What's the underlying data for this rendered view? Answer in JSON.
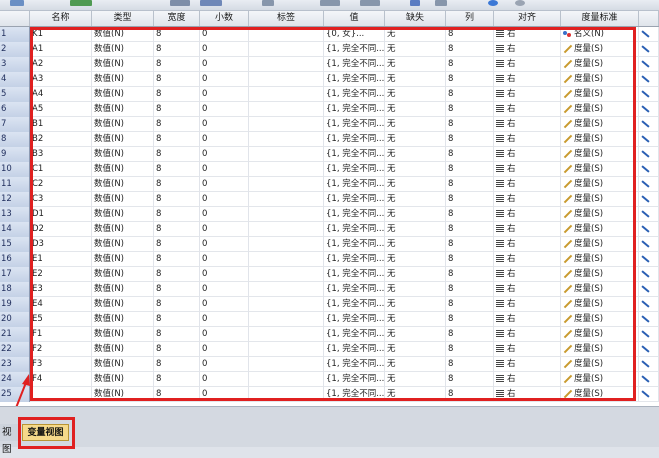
{
  "columns": [
    "名称",
    "类型",
    "宽度",
    "小数",
    "标签",
    "值",
    "缺失",
    "列",
    "对齐",
    "度量标准"
  ],
  "rows": [
    {
      "num": "1",
      "name": "K1",
      "type": "数值(N)",
      "width": "8",
      "decimals": "0",
      "label": "",
      "values": "{0, 女}...",
      "missing": "无",
      "columns": "8",
      "align": "右",
      "measure": "名义(N)",
      "measure_icon": "nominal-icon"
    },
    {
      "num": "2",
      "name": "A1",
      "type": "数值(N)",
      "width": "8",
      "decimals": "0",
      "label": "",
      "values": "{1, 完全不同...",
      "missing": "无",
      "columns": "8",
      "align": "右",
      "measure": "度量(S)",
      "measure_icon": "ruler-icon"
    },
    {
      "num": "3",
      "name": "A2",
      "type": "数值(N)",
      "width": "8",
      "decimals": "0",
      "label": "",
      "values": "{1, 完全不同...",
      "missing": "无",
      "columns": "8",
      "align": "右",
      "measure": "度量(S)",
      "measure_icon": "ruler-icon"
    },
    {
      "num": "4",
      "name": "A3",
      "type": "数值(N)",
      "width": "8",
      "decimals": "0",
      "label": "",
      "values": "{1, 完全不同...",
      "missing": "无",
      "columns": "8",
      "align": "右",
      "measure": "度量(S)",
      "measure_icon": "ruler-icon"
    },
    {
      "num": "5",
      "name": "A4",
      "type": "数值(N)",
      "width": "8",
      "decimals": "0",
      "label": "",
      "values": "{1, 完全不同...",
      "missing": "无",
      "columns": "8",
      "align": "右",
      "measure": "度量(S)",
      "measure_icon": "ruler-icon"
    },
    {
      "num": "6",
      "name": "A5",
      "type": "数值(N)",
      "width": "8",
      "decimals": "0",
      "label": "",
      "values": "{1, 完全不同...",
      "missing": "无",
      "columns": "8",
      "align": "右",
      "measure": "度量(S)",
      "measure_icon": "ruler-icon"
    },
    {
      "num": "7",
      "name": "B1",
      "type": "数值(N)",
      "width": "8",
      "decimals": "0",
      "label": "",
      "values": "{1, 完全不同...",
      "missing": "无",
      "columns": "8",
      "align": "右",
      "measure": "度量(S)",
      "measure_icon": "ruler-icon"
    },
    {
      "num": "8",
      "name": "B2",
      "type": "数值(N)",
      "width": "8",
      "decimals": "0",
      "label": "",
      "values": "{1, 完全不同...",
      "missing": "无",
      "columns": "8",
      "align": "右",
      "measure": "度量(S)",
      "measure_icon": "ruler-icon"
    },
    {
      "num": "9",
      "name": "B3",
      "type": "数值(N)",
      "width": "8",
      "decimals": "0",
      "label": "",
      "values": "{1, 完全不同...",
      "missing": "无",
      "columns": "8",
      "align": "右",
      "measure": "度量(S)",
      "measure_icon": "ruler-icon"
    },
    {
      "num": "10",
      "name": "C1",
      "type": "数值(N)",
      "width": "8",
      "decimals": "0",
      "label": "",
      "values": "{1, 完全不同...",
      "missing": "无",
      "columns": "8",
      "align": "右",
      "measure": "度量(S)",
      "measure_icon": "ruler-icon"
    },
    {
      "num": "11",
      "name": "C2",
      "type": "数值(N)",
      "width": "8",
      "decimals": "0",
      "label": "",
      "values": "{1, 完全不同...",
      "missing": "无",
      "columns": "8",
      "align": "右",
      "measure": "度量(S)",
      "measure_icon": "ruler-icon"
    },
    {
      "num": "12",
      "name": "C3",
      "type": "数值(N)",
      "width": "8",
      "decimals": "0",
      "label": "",
      "values": "{1, 完全不同...",
      "missing": "无",
      "columns": "8",
      "align": "右",
      "measure": "度量(S)",
      "measure_icon": "ruler-icon"
    },
    {
      "num": "13",
      "name": "D1",
      "type": "数值(N)",
      "width": "8",
      "decimals": "0",
      "label": "",
      "values": "{1, 完全不同...",
      "missing": "无",
      "columns": "8",
      "align": "右",
      "measure": "度量(S)",
      "measure_icon": "ruler-icon"
    },
    {
      "num": "14",
      "name": "D2",
      "type": "数值(N)",
      "width": "8",
      "decimals": "0",
      "label": "",
      "values": "{1, 完全不同...",
      "missing": "无",
      "columns": "8",
      "align": "右",
      "measure": "度量(S)",
      "measure_icon": "ruler-icon"
    },
    {
      "num": "15",
      "name": "D3",
      "type": "数值(N)",
      "width": "8",
      "decimals": "0",
      "label": "",
      "values": "{1, 完全不同...",
      "missing": "无",
      "columns": "8",
      "align": "右",
      "measure": "度量(S)",
      "measure_icon": "ruler-icon"
    },
    {
      "num": "16",
      "name": "E1",
      "type": "数值(N)",
      "width": "8",
      "decimals": "0",
      "label": "",
      "values": "{1, 完全不同...",
      "missing": "无",
      "columns": "8",
      "align": "右",
      "measure": "度量(S)",
      "measure_icon": "ruler-icon"
    },
    {
      "num": "17",
      "name": "E2",
      "type": "数值(N)",
      "width": "8",
      "decimals": "0",
      "label": "",
      "values": "{1, 完全不同...",
      "missing": "无",
      "columns": "8",
      "align": "右",
      "measure": "度量(S)",
      "measure_icon": "ruler-icon"
    },
    {
      "num": "18",
      "name": "E3",
      "type": "数值(N)",
      "width": "8",
      "decimals": "0",
      "label": "",
      "values": "{1, 完全不同...",
      "missing": "无",
      "columns": "8",
      "align": "右",
      "measure": "度量(S)",
      "measure_icon": "ruler-icon"
    },
    {
      "num": "19",
      "name": "E4",
      "type": "数值(N)",
      "width": "8",
      "decimals": "0",
      "label": "",
      "values": "{1, 完全不同...",
      "missing": "无",
      "columns": "8",
      "align": "右",
      "measure": "度量(S)",
      "measure_icon": "ruler-icon"
    },
    {
      "num": "20",
      "name": "E5",
      "type": "数值(N)",
      "width": "8",
      "decimals": "0",
      "label": "",
      "values": "{1, 完全不同...",
      "missing": "无",
      "columns": "8",
      "align": "右",
      "measure": "度量(S)",
      "measure_icon": "ruler-icon"
    },
    {
      "num": "21",
      "name": "F1",
      "type": "数值(N)",
      "width": "8",
      "decimals": "0",
      "label": "",
      "values": "{1, 完全不同...",
      "missing": "无",
      "columns": "8",
      "align": "右",
      "measure": "度量(S)",
      "measure_icon": "ruler-icon"
    },
    {
      "num": "22",
      "name": "F2",
      "type": "数值(N)",
      "width": "8",
      "decimals": "0",
      "label": "",
      "values": "{1, 完全不同...",
      "missing": "无",
      "columns": "8",
      "align": "右",
      "measure": "度量(S)",
      "measure_icon": "ruler-icon"
    },
    {
      "num": "23",
      "name": "F3",
      "type": "数值(N)",
      "width": "8",
      "decimals": "0",
      "label": "",
      "values": "{1, 完全不同...",
      "missing": "无",
      "columns": "8",
      "align": "右",
      "measure": "度量(S)",
      "measure_icon": "ruler-icon"
    },
    {
      "num": "24",
      "name": "F4",
      "type": "数值(N)",
      "width": "8",
      "decimals": "0",
      "label": "",
      "values": "{1, 完全不同...",
      "missing": "无",
      "columns": "8",
      "align": "右",
      "measure": "度量(S)",
      "measure_icon": "ruler-icon"
    },
    {
      "num": "25",
      "name": "",
      "type": "数值(N)",
      "width": "8",
      "decimals": "0",
      "label": "",
      "values": "{1, 完全不同...",
      "missing": "无",
      "columns": "8",
      "align": "右",
      "measure": "度量(S)",
      "measure_icon": "ruler-icon"
    }
  ],
  "tabs": {
    "data_view": "视图",
    "variable_view": "变量视图"
  },
  "colors": {
    "highlight": "#e02020",
    "active_tab": "#f6d98a",
    "row_header": "#c4d1e6"
  }
}
